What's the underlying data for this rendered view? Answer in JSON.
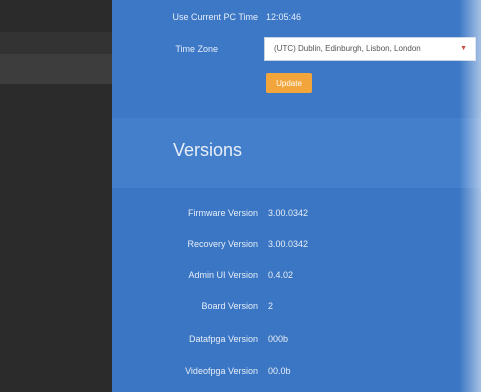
{
  "time": {
    "use_pc_time_label": "Use Current PC Time",
    "current_time": "12:05:46",
    "time_zone_label": "Time Zone",
    "time_zone_value": "(UTC) Dublin, Edinburgh, Lisbon, London",
    "update_label": "Update"
  },
  "versions": {
    "title": "Versions",
    "rows": [
      {
        "label": "Firmware Version",
        "value": "3.00.0342"
      },
      {
        "label": "Recovery Version",
        "value": "3.00.0342"
      },
      {
        "label": "Admin UI Version",
        "value": "0.4.02"
      },
      {
        "label": "Board Version",
        "value": "2"
      },
      {
        "label": "Datafpga Version",
        "value": "000b"
      },
      {
        "label": "Videofpga Version",
        "value": "00.0b"
      }
    ]
  },
  "colors": {
    "sidebar": "#2b2b2b",
    "main_panel": "#3b78c5",
    "update_button": "#f2a53a"
  }
}
